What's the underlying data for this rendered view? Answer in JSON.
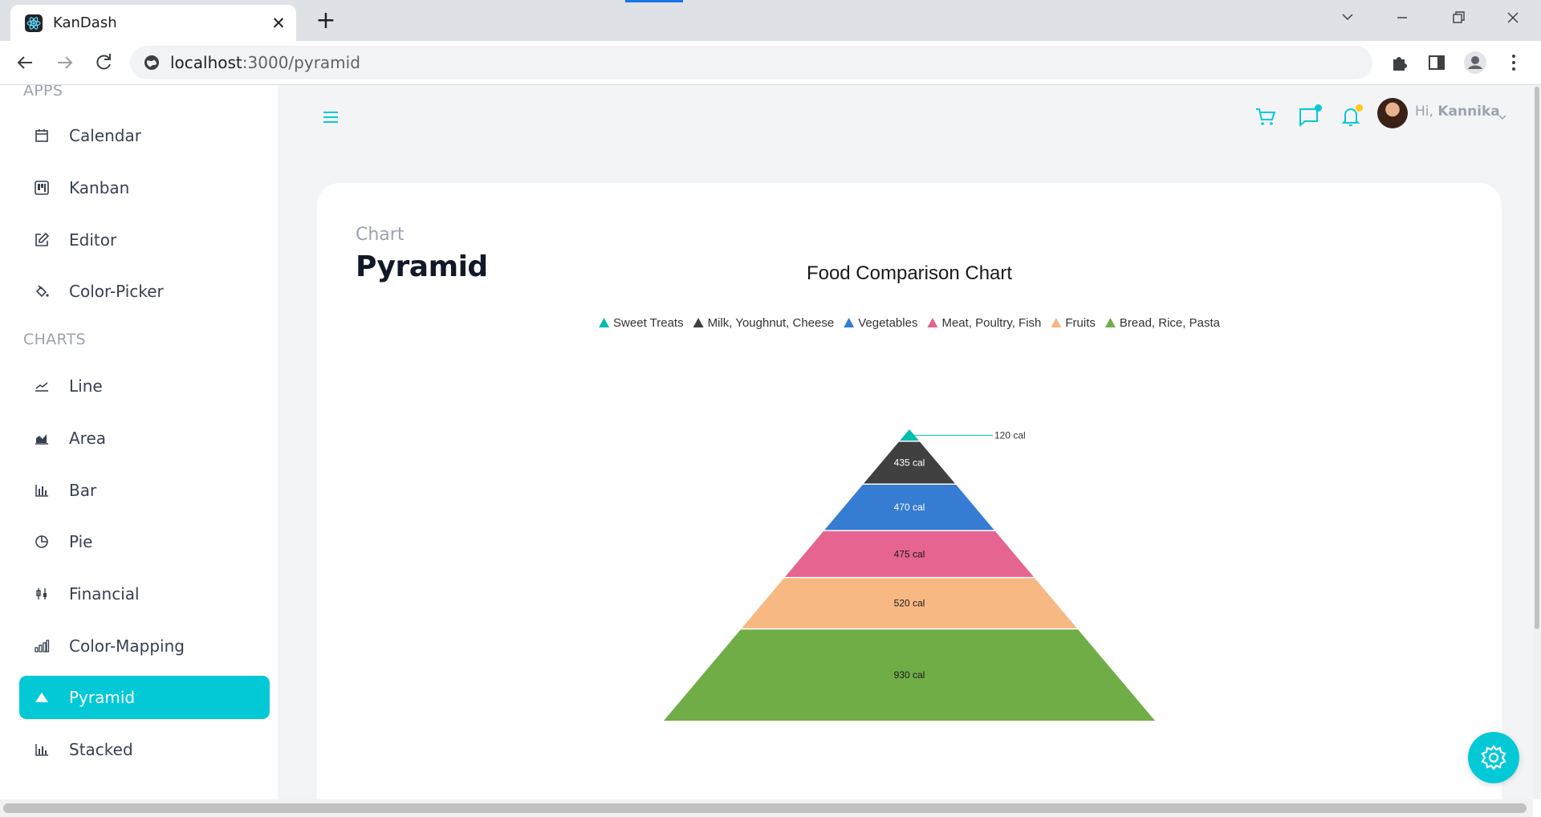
{
  "browser": {
    "tab_title": "KanDash",
    "url_host": "localhost",
    "url_path": ":3000/pyramid",
    "icons": [
      "react-logo-icon",
      "close-icon",
      "plus-icon",
      "chevron-down-icon",
      "minimize-icon",
      "restore-icon",
      "close-window-icon",
      "back-arrow-icon",
      "forward-arrow-icon",
      "reload-icon",
      "site-info-icon",
      "extensions-icon",
      "side-panel-icon",
      "profile-icon",
      "more-vert-icon"
    ]
  },
  "sidebar": {
    "apps_heading": "APPS",
    "charts_heading": "CHARTS",
    "apps": [
      {
        "label": "Calendar",
        "icon": "calendar-icon"
      },
      {
        "label": "Kanban",
        "icon": "kanban-icon"
      },
      {
        "label": "Editor",
        "icon": "edit-icon"
      },
      {
        "label": "Color-Picker",
        "icon": "paint-bucket-icon"
      }
    ],
    "charts": [
      {
        "label": "Line",
        "icon": "line-chart-icon"
      },
      {
        "label": "Area",
        "icon": "area-chart-icon"
      },
      {
        "label": "Bar",
        "icon": "bar-chart-icon"
      },
      {
        "label": "Pie",
        "icon": "pie-chart-icon"
      },
      {
        "label": "Financial",
        "icon": "candlestick-icon"
      },
      {
        "label": "Color-Mapping",
        "icon": "color-mapping-icon"
      },
      {
        "label": "Pyramid",
        "icon": "pyramid-icon",
        "active": true
      },
      {
        "label": "Stacked",
        "icon": "stacked-chart-icon"
      }
    ],
    "accent_color": "#03c9d7"
  },
  "header": {
    "greeting_prefix": "Hi,",
    "user_name": "Kannika",
    "icons": [
      "menu-icon",
      "cart-icon",
      "chat-icon",
      "bell-icon",
      "avatar",
      "chevron-down-icon"
    ]
  },
  "page": {
    "category": "Chart",
    "title": "Pyramid"
  },
  "chart_data": {
    "type": "pyramid",
    "title": "Food Comparison Chart",
    "legend_position": "top",
    "categories": [
      "Sweet Treats",
      "Milk, Youghnut, Cheese",
      "Vegetables",
      "Meat, Poultry, Fish",
      "Fruits",
      "Bread, Rice, Pasta"
    ],
    "values": [
      120,
      435,
      470,
      475,
      520,
      930
    ],
    "labels": [
      "120 cal",
      "435 cal",
      "470 cal",
      "475 cal",
      "520 cal",
      "930 cal"
    ],
    "colors": [
      "#00bdae",
      "#404041",
      "#357cd2",
      "#e56590",
      "#f8b883",
      "#70ad47"
    ],
    "label_colors": [
      "#333333",
      "#ffffff",
      "#ffffff",
      "#1a1a1a",
      "#1a1a1a",
      "#1a1a1a"
    ]
  },
  "settings_icon": "gear-icon"
}
